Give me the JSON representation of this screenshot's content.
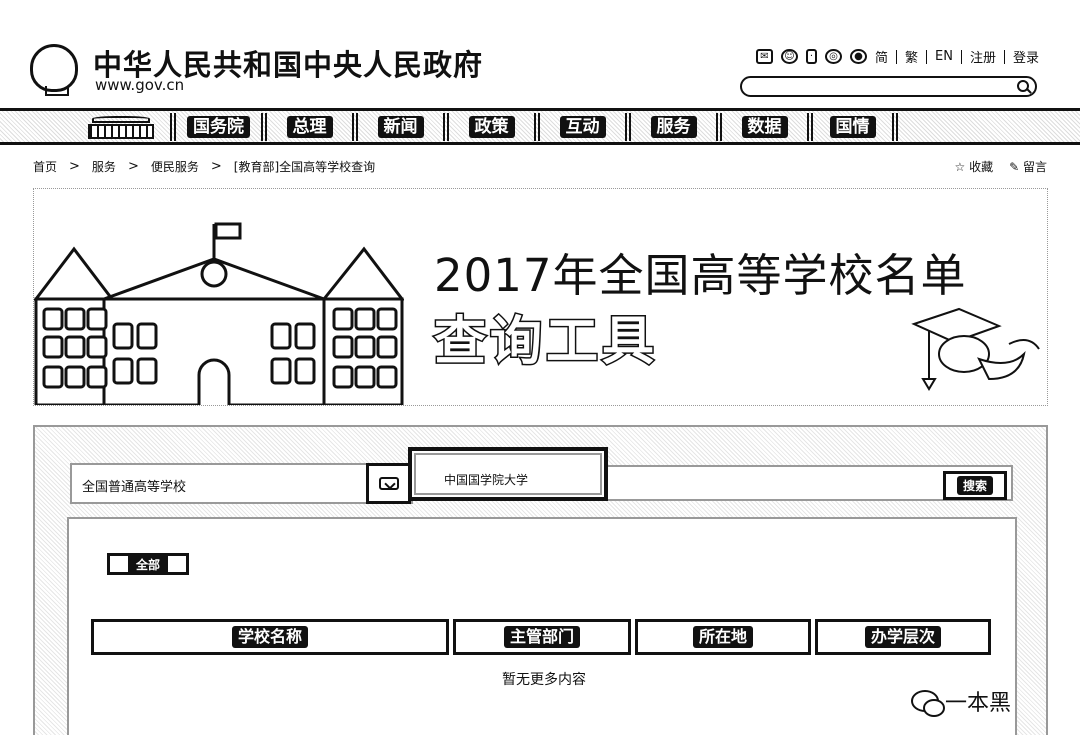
{
  "header": {
    "site_title": "中华人民共和国中央人民政府",
    "site_url": "www.gov.cn",
    "tools": {
      "simplified": "简",
      "traditional": "繁",
      "english": "EN",
      "register": "注册",
      "login": "登录"
    },
    "search_placeholder": ""
  },
  "nav": {
    "items": [
      "国务院",
      "总理",
      "新闻",
      "政策",
      "互动",
      "服务",
      "数据",
      "国情"
    ]
  },
  "breadcrumb": {
    "items": [
      "首页",
      "服务",
      "便民服务",
      "[教育部]全国高等学校查询"
    ],
    "separator": ">"
  },
  "page_actions": {
    "favorite": "收藏",
    "comment": "留言"
  },
  "banner": {
    "title": "2017年全国高等学校名单",
    "subtitle": "查询工具"
  },
  "search": {
    "category_value": "全国普通高等学校",
    "query_value": "中国国学院大学",
    "submit_label": "搜索"
  },
  "results": {
    "filter_all": "全部",
    "columns": [
      "学校名称",
      "主管部门",
      "所在地",
      "办学层次"
    ],
    "empty_message": "暂无更多内容"
  },
  "watermark": {
    "text": "一本黑"
  }
}
